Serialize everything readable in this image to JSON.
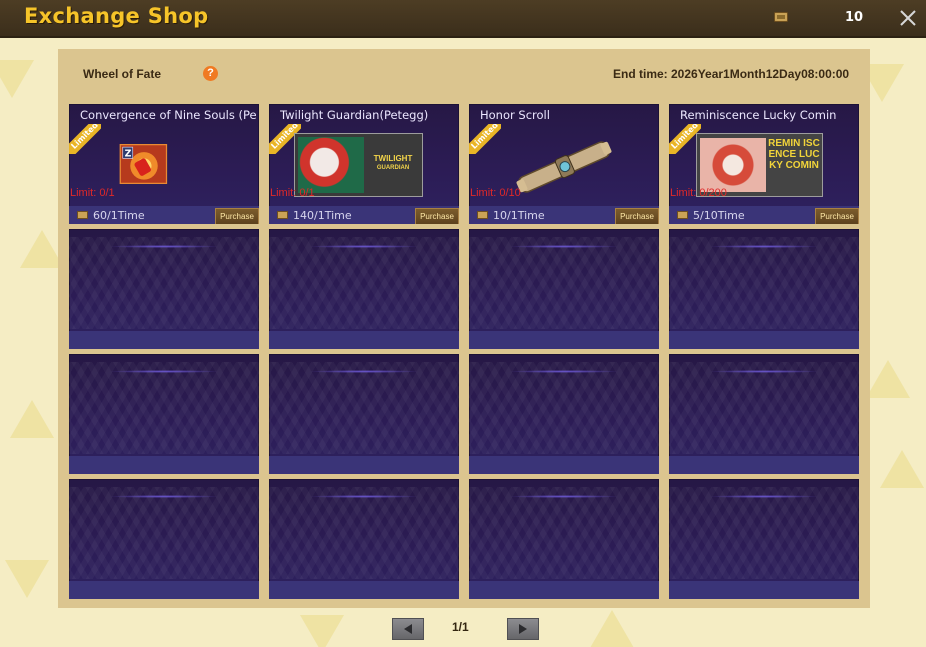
{
  "window": {
    "title": "Exchange Shop",
    "currency_icon": "ticket-icon",
    "currency_count": "10",
    "close_icon": "close-icon"
  },
  "header": {
    "event_name": "Wheel of Fate",
    "help_icon": "?",
    "end_time": "End time: 2026Year1Month12Day08:00:00"
  },
  "items": [
    {
      "name": "Convergence of Nine Souls (Pe",
      "ribbon": "Limited",
      "limit": "Limit: 0/1",
      "price": "60/1Time",
      "button": "Purchase",
      "image": "nine-souls-icon"
    },
    {
      "name": "Twilight Guardian(Petegg)",
      "ribbon": "Limited",
      "limit": "Limit: 0/1",
      "price": "140/1Time",
      "button": "Purchase",
      "image": "twilight-guardian-card",
      "image_text": "TWILIGHT",
      "image_subtext": "GUARDIAN"
    },
    {
      "name": "Honor Scroll",
      "ribbon": "Limited",
      "limit": "Limit: 0/10",
      "price": "10/1Time",
      "button": "Purchase",
      "image": "scroll-icon"
    },
    {
      "name": "Reminiscence Lucky Comin",
      "ribbon": "Limited",
      "limit": "Limit: 0/200",
      "price": "5/10Time",
      "button": "Purchase",
      "image": "reminiscence-card",
      "image_text": "REMIN ISCENCE LUCKY COMIN"
    }
  ],
  "empty_slots": 12,
  "pagination": {
    "label": "1/1",
    "prev_icon": "triangle-left-icon",
    "next_icon": "triangle-right-icon"
  },
  "colors": {
    "title": "#f6c429",
    "limit": "#e02828",
    "ribbon": "#e9b526",
    "cell_bg": "#2c1c55"
  }
}
